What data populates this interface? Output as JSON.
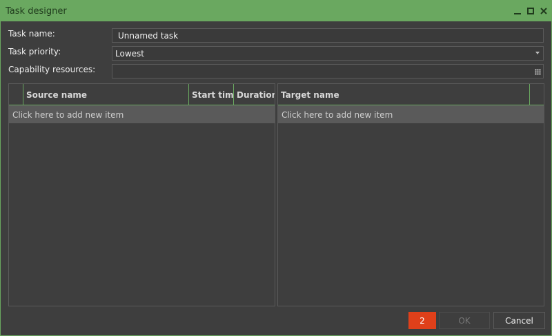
{
  "window": {
    "title": "Task designer"
  },
  "form": {
    "task_name_label": "Task name:",
    "task_name_value": "Unnamed task",
    "task_priority_label": "Task priority:",
    "task_priority_value": "Lowest",
    "capability_label": "Capability resources:",
    "capability_value": ""
  },
  "source_grid": {
    "columns": [
      "Source name",
      "Start time",
      "Duration"
    ],
    "add_row_text": "Click here to add new item"
  },
  "target_grid": {
    "columns": [
      "Target name"
    ],
    "add_row_text": "Click here to add new item"
  },
  "footer": {
    "error_count": "2",
    "ok_label": "OK",
    "cancel_label": "Cancel"
  },
  "colors": {
    "accent": "#6aa860",
    "error": "#e0401a",
    "background": "#3e3e3e"
  }
}
